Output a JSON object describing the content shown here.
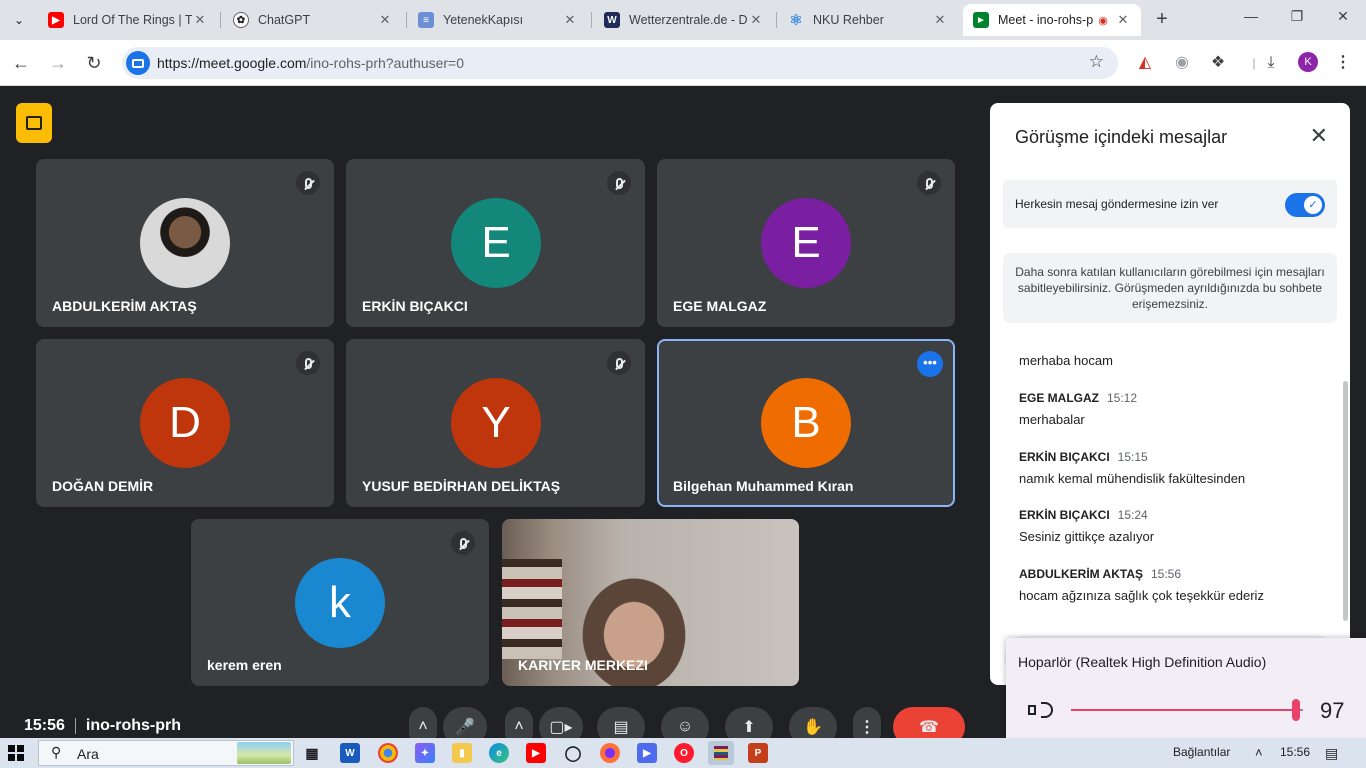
{
  "browser": {
    "tabs": [
      {
        "title": "Lord Of The Rings | T|",
        "icon": "youtube-icon",
        "color": "#ff0000"
      },
      {
        "title": "ChatGPT",
        "icon": "chatgpt-icon",
        "color": "#ffffff"
      },
      {
        "title": "YetenekKapısı",
        "icon": "yetenekkapisi-icon",
        "color": "#6d8fd6"
      },
      {
        "title": "Wetterzentrale.de - D",
        "icon": "wetterzentrale-icon",
        "color": "#1f2c59"
      },
      {
        "title": "NKU Rehber",
        "icon": "react-icon",
        "color": "#4a90e2"
      },
      {
        "title": "Meet - ino-rohs-p",
        "icon": "google-meet-icon",
        "color": "#00832d"
      }
    ],
    "url_host": "https://meet.google.com",
    "url_path": "/ino-rohs-prh?authuser=0",
    "profile_initial": "K"
  },
  "meet": {
    "accent": "#8ab4f8",
    "tiles": [
      {
        "name": "ABDULKERİM AKTAŞ",
        "initial": "",
        "color": "#3c4043",
        "muted": true
      },
      {
        "name": "ERKİN BIÇAKCI",
        "initial": "E",
        "color": "#12877a",
        "muted": true
      },
      {
        "name": "EGE MALGAZ",
        "initial": "E",
        "color": "#7b1fa2",
        "muted": true
      },
      {
        "name": "DOĞAN DEMİR",
        "initial": "D",
        "color": "#bf360c",
        "muted": true
      },
      {
        "name": "YUSUF BEDİRHAN DELİKTAŞ",
        "initial": "Y",
        "color": "#bf360c",
        "muted": true
      },
      {
        "name": "Bilgehan Muhammed Kıran",
        "initial": "B",
        "color": "#ef6c00",
        "muted": false
      },
      {
        "name": "kerem eren",
        "initial": "k",
        "color": "#1a88d0",
        "muted": true
      },
      {
        "name": "KARIYER MERKEZI",
        "initial": "",
        "color": "#3c4043",
        "muted": false
      }
    ],
    "time": "15:56",
    "meeting_code": "ino-rohs-prh"
  },
  "chat": {
    "title": "Görüşme içindeki mesajlar",
    "allow_label": "Herkesin mesaj göndermesine izin ver",
    "allow_enabled": true,
    "pin_info": "Daha sonra katılan kullanıcıların görebilmesi için mesajları sabitleyebilirsiniz. Görüşmeden ayrıldığınızda bu sohbete erişemezsiniz.",
    "messages": [
      {
        "sender": "",
        "time": "",
        "text": "merhaba hocam"
      },
      {
        "sender": "EGE MALGAZ",
        "time": "15:12",
        "text": "merhabalar"
      },
      {
        "sender": "ERKİN BIÇAKCI",
        "time": "15:15",
        "text": "namık kemal mühendislik fakültesinden"
      },
      {
        "sender": "ERKİN BIÇAKCI",
        "time": "15:24",
        "text": "Sesiniz gittikçe azalıyor"
      },
      {
        "sender": "ABDULKERİM AKTAŞ",
        "time": "15:56",
        "text": "hocam ağzınıza sağlık çok teşekkür ederiz"
      }
    ]
  },
  "volume": {
    "device": "Hoparlör (Realtek High Definition Audio)",
    "level": 97,
    "accent": "#e8416b"
  },
  "taskbar": {
    "search_placeholder": "Ara",
    "connections_label": "Bağlantılar",
    "clock": "15:56"
  }
}
